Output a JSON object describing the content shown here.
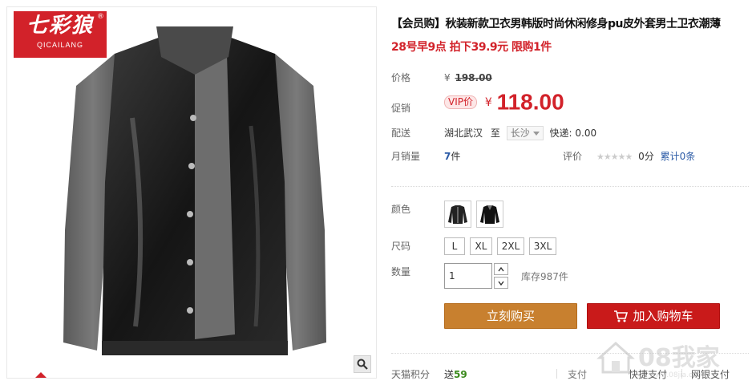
{
  "brand": {
    "name_cn": "七彩狼",
    "name_en": "QICAILANG",
    "reg": "®"
  },
  "product": {
    "title": "【会员购】秋装新款卫衣男韩版时尚休闲修身pu皮外套男士卫衣潮薄",
    "promo": "28号早9点 拍下39.9元 限购1件"
  },
  "price": {
    "label": "价格",
    "yen": "¥",
    "original": "198.00"
  },
  "promo_price": {
    "label": "促销",
    "vip_tag": "VIP价",
    "yen": "¥",
    "value": "118.00"
  },
  "shipping": {
    "label": "配送",
    "from": "湖北武汉",
    "to_word": "至",
    "to_city": "长沙",
    "fee": "快递: 0.00"
  },
  "sales": {
    "label": "月销量",
    "count": "7",
    "unit": "件",
    "review_label": "评价",
    "stars": "★★★★★",
    "score": "0分",
    "review_link": "累计0条"
  },
  "colors": {
    "label": "颜色",
    "options": [
      "black-leather-jacket",
      "black-leather-jacket-alt"
    ]
  },
  "sizes": {
    "label": "尺码",
    "options": [
      "L",
      "XL",
      "2XL",
      "3XL"
    ]
  },
  "quantity": {
    "label": "数量",
    "value": "1",
    "stock": "库存987件"
  },
  "actions": {
    "buy_now": "立刻购买",
    "add_cart": "加入购物车"
  },
  "footer": {
    "points_label": "天猫积分",
    "points_prefix": "送",
    "points_value": "59",
    "pay_label": "支付",
    "fast_pay": "快捷支付",
    "bank_pay": "网银支付"
  },
  "watermark": {
    "text": "08我家",
    "url": "www.08jia.com"
  },
  "icons": {
    "zoom": "magnifier-icon",
    "cart": "cart-icon",
    "qty_up": "chevron-up-icon",
    "qty_down": "chevron-down-icon"
  },
  "colors_theme": {
    "accent": "#d2222a",
    "buy_now_bg": "#c8802f",
    "add_cart_bg": "#c91a1a",
    "link": "#2b5aa6"
  }
}
